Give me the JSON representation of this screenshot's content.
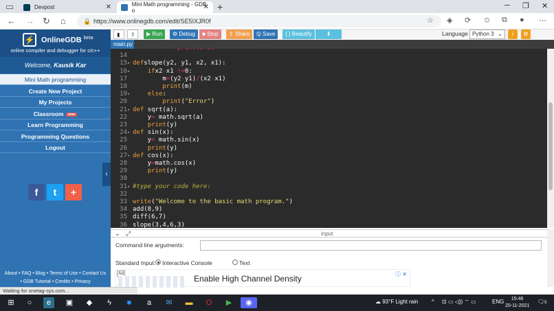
{
  "browser": {
    "tabs": [
      {
        "title": "Devpost",
        "icon": "devpost-icon"
      },
      {
        "title": "Mini Math programming - GDB o",
        "icon": "onlinegdb-icon"
      }
    ],
    "url": "https://www.onlinegdb.com/edit/SE5IXJR0f"
  },
  "sidebar": {
    "brand": "OnlineGDB",
    "brand_beta": "beta",
    "brand_sub": "online compiler and debugger for c/c++",
    "welcome_prefix": "Welcome,",
    "welcome_user": "Kausik Kar",
    "menu": [
      {
        "label": "Mini Math programming",
        "active": true
      },
      {
        "label": "Create New Project"
      },
      {
        "label": "My Projects"
      },
      {
        "label": "Classroom",
        "badge": "new"
      },
      {
        "label": "Learn Programming"
      },
      {
        "label": "Programming Questions"
      },
      {
        "label": "Logout"
      }
    ],
    "social": [
      "f",
      "t",
      "+"
    ],
    "footer_line1": "About • FAQ • Blog • Terms of Use • Contact Us",
    "footer_line2": "• GDB Tutorial • Credits • Privacy"
  },
  "toolbar": {
    "run": "Run",
    "debug": "Debug",
    "stop": "Stop",
    "share": "Share",
    "save": "Save",
    "beautify": "{ } Beautify",
    "language_label": "Language",
    "language_value": "Python 3"
  },
  "file_tab": "main.py",
  "code": [
    {
      "n": "",
      "html": "            print(a-b)",
      "fold": false
    },
    {
      "n": "14",
      "text": ""
    },
    {
      "n": "15",
      "fold": true,
      "parts": [
        [
          "kw",
          "def"
        ],
        [
          "",
          "slope(y2, y1, x2, x1):"
        ]
      ]
    },
    {
      "n": "16",
      "fold": true,
      "parts": [
        [
          "",
          "    "
        ],
        [
          "kw",
          "if"
        ],
        [
          "",
          "x2"
        ],
        [
          "op",
          "-"
        ],
        [
          "",
          "x1 "
        ],
        [
          "op",
          "!="
        ],
        [
          "",
          "0:"
        ]
      ]
    },
    {
      "n": "17",
      "parts": [
        [
          "",
          "        m"
        ],
        [
          "op",
          "="
        ],
        [
          "",
          "(y2"
        ],
        [
          "op",
          "-"
        ],
        [
          "",
          "y1)"
        ],
        [
          "op",
          "/"
        ],
        [
          "",
          "(x2"
        ],
        [
          "op",
          "-"
        ],
        [
          "",
          "x1)"
        ]
      ]
    },
    {
      "n": "18",
      "parts": [
        [
          "",
          "        "
        ],
        [
          "kw",
          "print"
        ],
        [
          "",
          "(m)"
        ]
      ]
    },
    {
      "n": "19",
      "fold": true,
      "parts": [
        [
          "",
          "    "
        ],
        [
          "kw",
          "else"
        ],
        [
          ":",
          ":"
        ]
      ]
    },
    {
      "n": "20",
      "parts": [
        [
          "",
          "        "
        ],
        [
          "kw",
          "print"
        ],
        [
          "",
          "("
        ],
        [
          "str",
          "\"Error\""
        ],
        [
          "",
          ")"
        ]
      ]
    },
    {
      "n": "21",
      "fold": true,
      "parts": [
        [
          "kw",
          "def"
        ],
        [
          "",
          " sqrt(a):"
        ]
      ]
    },
    {
      "n": "22",
      "parts": [
        [
          "",
          "    y"
        ],
        [
          "op",
          "="
        ],
        [
          "",
          " math.sqrt(a)"
        ]
      ]
    },
    {
      "n": "23",
      "parts": [
        [
          "",
          "    "
        ],
        [
          "kw",
          "print"
        ],
        [
          "",
          "(y)"
        ]
      ]
    },
    {
      "n": "24",
      "fold": true,
      "parts": [
        [
          "kw",
          "def"
        ],
        [
          "",
          " sin(x):"
        ]
      ]
    },
    {
      "n": "25",
      "parts": [
        [
          "",
          "    y"
        ],
        [
          "op",
          "="
        ],
        [
          "",
          " math.sin(x)"
        ]
      ]
    },
    {
      "n": "26",
      "parts": [
        [
          "",
          "    "
        ],
        [
          "kw",
          "print"
        ],
        [
          "",
          "(y)"
        ]
      ]
    },
    {
      "n": "27",
      "fold": true,
      "parts": [
        [
          "kw",
          "def"
        ],
        [
          "",
          " cos(x):"
        ]
      ]
    },
    {
      "n": "28",
      "parts": [
        [
          "",
          "    y"
        ],
        [
          "op",
          "="
        ],
        [
          "",
          "math.cos(x)"
        ]
      ]
    },
    {
      "n": "29",
      "parts": [
        [
          "",
          "    "
        ],
        [
          "kw",
          "print"
        ],
        [
          "",
          "(y)"
        ]
      ]
    },
    {
      "n": "30",
      "parts": []
    },
    {
      "n": "31",
      "fold": true,
      "parts": [
        [
          "cm",
          "#type your code here:"
        ]
      ]
    },
    {
      "n": "32",
      "parts": []
    },
    {
      "n": "33",
      "parts": [
        [
          "kw",
          "write"
        ],
        [
          "",
          "("
        ],
        [
          "str",
          "\"Welcome to the basic math program.\""
        ],
        [
          "",
          ")"
        ]
      ]
    },
    {
      "n": "34",
      "parts": [
        [
          "",
          "add(8,9)"
        ]
      ]
    },
    {
      "n": "35",
      "parts": [
        [
          "",
          "diff(6,7)"
        ]
      ]
    },
    {
      "n": "36",
      "parts": [
        [
          "",
          "slope(3,4,6,3)"
        ]
      ]
    }
  ],
  "io": {
    "title": "input",
    "cmd_label": "Command line arguments:",
    "stdin_label": "Standard Input:",
    "opt_console": "Interactive Console",
    "opt_text": "Text"
  },
  "ad": {
    "tag": "Ad",
    "text": "Enable High Channel Density"
  },
  "status": "Waiting for onetag-sys.com...",
  "taskbar": {
    "weather": "93°F  Light rain",
    "lang": "ENG",
    "time": "15:46",
    "date": "20-11-2021",
    "notif": "5"
  }
}
